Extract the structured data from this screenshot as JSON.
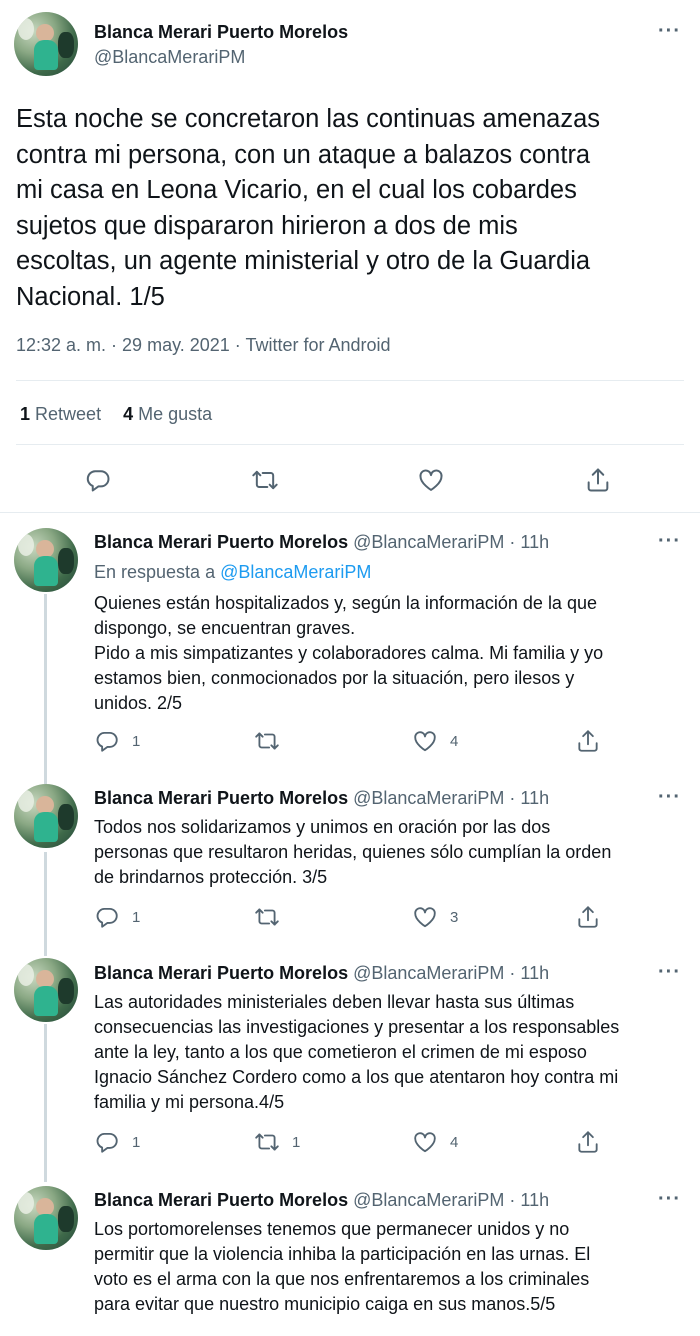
{
  "author": {
    "name": "Blanca Merari Puerto Morelos",
    "handle": "@BlancaMerariPM"
  },
  "main_tweet": {
    "more": "···",
    "text": "Esta noche se concretaron las continuas amenazas\ncontra mi persona, con un ataque a balazos contra\nmi casa en Leona Vicario, en el cual los cobardes\nsujetos que dispararon hirieron a dos de mis\nescoltas, un agente ministerial y otro de la Guardia\nNacional. 1/5",
    "meta": "12:32 a. m. · 29 may. 2021 · Twitter for Android",
    "retweets_count": "1",
    "retweets_label": "Retweet",
    "likes_count": "4",
    "likes_label": "Me gusta"
  },
  "replies": [
    {
      "time": "· 11h",
      "in_reply_prefix": "En respuesta a ",
      "in_reply_handle": "@BlancaMerariPM",
      "text": "Quienes están hospitalizados y, según la información de la que\ndispongo, se encuentran graves.\nPido a mis simpatizantes y colaboradores calma. Mi familia y yo\nestamos bien, conmocionados por la situación, pero ilesos y\nunidos. 2/5",
      "reply_count": "1",
      "retweet_count": "",
      "like_count": "4"
    },
    {
      "time": "· 11h",
      "text": "Todos nos solidarizamos y unimos en oración por las dos\npersonas que resultaron heridas, quienes sólo cumplían la orden\nde brindarnos protección. 3/5",
      "reply_count": "1",
      "retweet_count": "",
      "like_count": "3"
    },
    {
      "time": "· 11h",
      "text": "Las autoridades ministeriales deben llevar hasta sus últimas\nconsecuencias las investigaciones y presentar a los responsables\nante la ley, tanto a los que cometieron el crimen de mi esposo\nIgnacio Sánchez Cordero como a los que atentaron hoy contra mi\nfamilia y mi persona.4/5",
      "reply_count": "1",
      "retweet_count": "1",
      "like_count": "4"
    },
    {
      "time": "· 11h",
      "text": "Los portomorelenses tenemos que permanecer unidos y no\npermitir que la violencia inhiba la participación en las urnas. El\nvoto es el arma con la que nos enfrentaremos a los criminales\npara evitar que nuestro municipio caiga en sus manos.5/5"
    }
  ],
  "icons": {
    "reply": "reply-icon",
    "retweet": "retweet-icon",
    "like": "heart-icon",
    "share": "share-icon",
    "more": "more-icon"
  },
  "colors": {
    "text": "#0f1419",
    "secondary": "#536471",
    "link": "#1d9bf0",
    "divider": "#e6ecf0"
  }
}
